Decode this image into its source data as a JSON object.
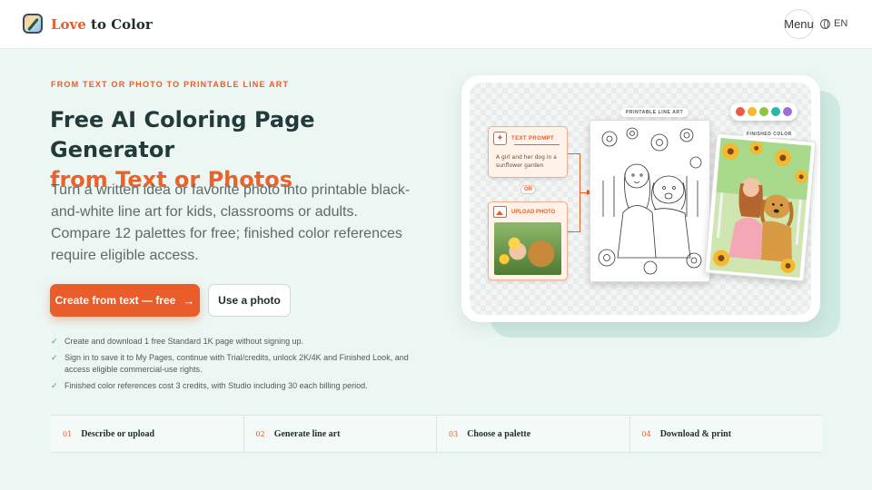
{
  "brand": {
    "love": "Love",
    "rest": " to Color"
  },
  "header": {
    "menu_label": "Menu",
    "lang_label": "EN"
  },
  "hero": {
    "eyebrow": "FROM TEXT OR PHOTO TO PRINTABLE LINE ART",
    "title_line1": "Free AI Coloring Page Generator",
    "title_line2": "from Text or Photos",
    "lede": "Turn a written idea or favorite photo into printable black-and-white line art for kids, classrooms or adults. Compare 12 palettes for free; finished color references require eligible access.",
    "primary_button": "Create from text — free",
    "secondary_button": "Use a photo"
  },
  "benefits": [
    "Create and download 1 free Standard 1K page without signing up.",
    "Sign in to save it to My Pages, continue with Trial/credits, unlock 2K/4K and Finished Look, and access eligible commercial-use rights.",
    "Finished color references cost 3 credits, with Studio including 30 each billing period."
  ],
  "steps": [
    {
      "num": "01",
      "label": "Describe or upload"
    },
    {
      "num": "02",
      "label": "Generate line art"
    },
    {
      "num": "03",
      "label": "Choose a palette"
    },
    {
      "num": "04",
      "label": "Download & print"
    }
  ],
  "illustration": {
    "prompt_title": "TEXT PROMPT",
    "prompt_text": "A girl and her dog in a sunflower garden",
    "or_label": "OR",
    "upload_title": "UPLOAD PHOTO",
    "lineart_tag": "PRINTABLE LINE ART",
    "finished_tag": "FINISHED COLOR",
    "palette_colors": [
      "#f0594a",
      "#f5b82e",
      "#8cc63f",
      "#2ab7a9",
      "#9b6fd6"
    ]
  },
  "colors": {
    "accent": "#e85d2a",
    "background": "#ecf7f4",
    "heading": "#223b3a"
  }
}
